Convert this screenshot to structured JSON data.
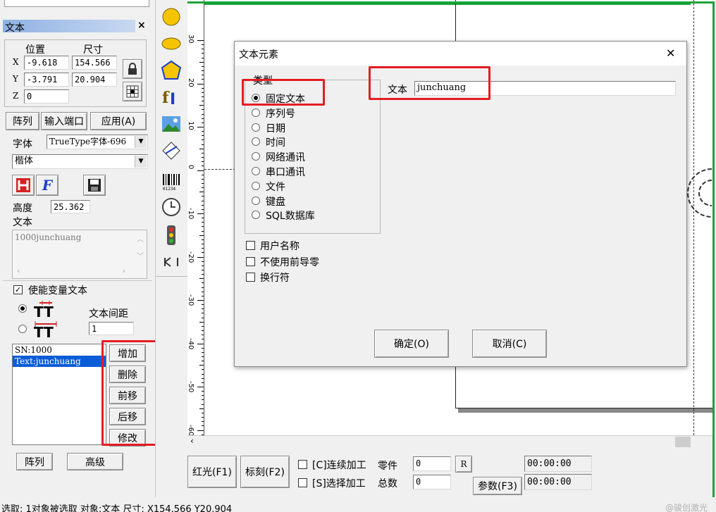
{
  "panel": {
    "title": "文本",
    "close": "×",
    "pos_header": "位置",
    "size_header": "尺寸",
    "x_label": "X",
    "y_label": "Y",
    "z_label": "Z",
    "x_value": "-9.618",
    "y_value": "-3.791",
    "z_value": "0",
    "w_value": "154.566",
    "h_value": "20.904",
    "array_btn": "阵列",
    "input_port_btn": "输入端口",
    "apply_btn": "应用(A)",
    "font_label": "字体",
    "font_type": "TrueType字体-696",
    "font_name": "楷体",
    "height_label": "高度",
    "height_value": "25.362",
    "text_label": "文本",
    "text_value": "1000junchuang",
    "enable_var_text": "使能变量文本",
    "text_spacing_label": "文本间距",
    "text_spacing_value": "1",
    "var_items": [
      "SN:1000",
      "Text:junchuang"
    ],
    "add_btn": "增加",
    "delete_btn": "删除",
    "move_up_btn": "前移",
    "move_down_btn": "后移",
    "modify_btn": "修改",
    "bottom_array_btn": "阵列",
    "advanced_btn": "高级"
  },
  "bottom": {
    "red_light_btn": "红光(F1)",
    "mark_btn": "标刻(F2)",
    "continuous": "[C]连续加工",
    "select_process": "[S]选择加工",
    "parts_label": "零件",
    "parts_value": "0",
    "total_label": "总数",
    "total_value": "0",
    "r_btn": "R",
    "params_btn": "参数(F3)",
    "time1": "00:00:00",
    "time2": "00:00:00"
  },
  "status": {
    "text": "选取: 1对象被选取 对象:文本 尺寸: X154.566 Y20.904",
    "watermark": "@骏创激光"
  },
  "ruler": {
    "labels": [
      "30",
      "20",
      "10",
      "0",
      "-10",
      "-20",
      "-30",
      "-40",
      "-50",
      "-60"
    ]
  },
  "dialog": {
    "title": "文本元素",
    "close": "✕",
    "type_group": "类型",
    "types": [
      "固定文本",
      "序列号",
      "日期",
      "时间",
      "网络通讯",
      "串口通讯",
      "文件",
      "键盘",
      "SQL数据库"
    ],
    "selected_type": 0,
    "text_label": "文本",
    "text_value": "junchuang",
    "opt_username": "用户名称",
    "opt_no_leading_zero": "不使用前导零",
    "opt_newline": "换行符",
    "ok_btn": "确定(O)",
    "cancel_btn": "取消(C)"
  },
  "colors": {
    "accent_border": "#1aa33a",
    "highlight_red": "#e51c23",
    "selection": "#0a5cd6",
    "panel_title_grad": "#9cbbe6"
  }
}
